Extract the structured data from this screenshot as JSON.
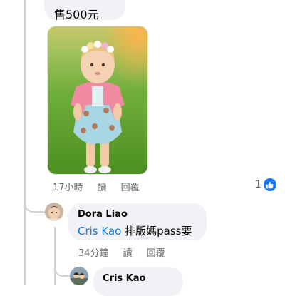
{
  "top_comment": {
    "text_visible": "售500元"
  },
  "photo_comment": {
    "time": "17小時",
    "read_label": "讀",
    "reply_label": "回覆",
    "like_count": "1"
  },
  "reply1": {
    "author": "Dora  Liao",
    "mention": "Cris Kao",
    "text": " 排版媽pass要",
    "time": "34分鐘",
    "read_label": "讀",
    "reply_label": "回覆"
  },
  "reply2": {
    "author": "Cris Kao"
  },
  "colors": {
    "mention": "#1876d2",
    "like": "#1877f2",
    "meta": "#65676b",
    "bubble": "#f0f2f5"
  },
  "icons": [
    "thumbs-up-icon",
    "avatar-dora",
    "avatar-cris"
  ]
}
